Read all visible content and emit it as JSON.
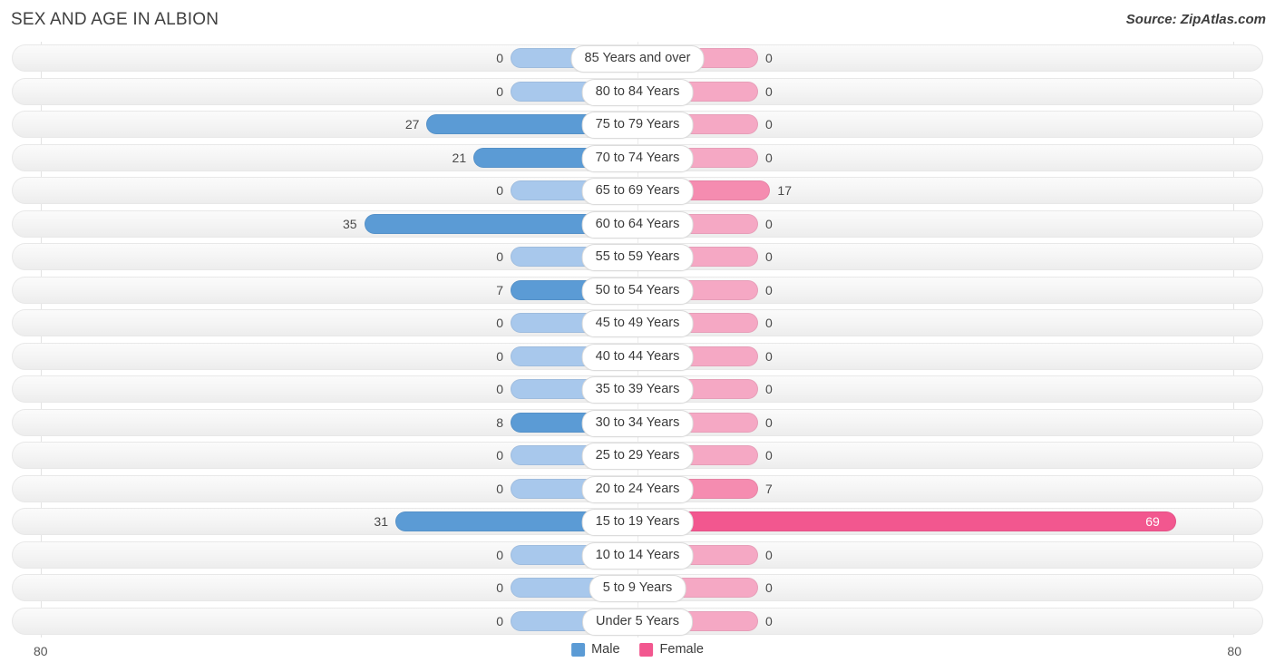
{
  "header": {
    "title": "SEX AND AGE IN ALBION",
    "source": "Source: ZipAtlas.com"
  },
  "legend": {
    "male_label": "Male",
    "female_label": "Female",
    "male_color": "#5b9bd5",
    "female_color": "#f2578f"
  },
  "axis": {
    "left_label": "80",
    "right_label": "80",
    "max": 80
  },
  "colors": {
    "male_active": "#5b9bd5",
    "male_zero": "#a8c8ec",
    "female_active": "#f2578f",
    "female_mid": "#f58cb0",
    "female_zero": "#f5a8c4",
    "track": "#f4f4f4"
  },
  "chart_data": {
    "type": "bar",
    "subtype": "population-pyramid",
    "title": "SEX AND AGE IN ALBION",
    "xlabel": "",
    "ylabel": "",
    "xlim": [
      80,
      80
    ],
    "grid": true,
    "legend_position": "bottom-center",
    "categories": [
      "85 Years and over",
      "80 to 84 Years",
      "75 to 79 Years",
      "70 to 74 Years",
      "65 to 69 Years",
      "60 to 64 Years",
      "55 to 59 Years",
      "50 to 54 Years",
      "45 to 49 Years",
      "40 to 44 Years",
      "35 to 39 Years",
      "30 to 34 Years",
      "25 to 29 Years",
      "20 to 24 Years",
      "15 to 19 Years",
      "10 to 14 Years",
      "5 to 9 Years",
      "Under 5 Years"
    ],
    "series": [
      {
        "name": "Male",
        "values": [
          0,
          0,
          27,
          21,
          0,
          35,
          0,
          7,
          0,
          0,
          0,
          8,
          0,
          0,
          31,
          0,
          0,
          0
        ]
      },
      {
        "name": "Female",
        "values": [
          0,
          0,
          0,
          0,
          17,
          0,
          0,
          0,
          0,
          0,
          0,
          0,
          0,
          7,
          69,
          0,
          0,
          0
        ]
      }
    ]
  },
  "rows": [
    {
      "category": "85 Years and over",
      "male": 0,
      "male_text": "0",
      "female": 0,
      "female_text": "0"
    },
    {
      "category": "80 to 84 Years",
      "male": 0,
      "male_text": "0",
      "female": 0,
      "female_text": "0"
    },
    {
      "category": "75 to 79 Years",
      "male": 27,
      "male_text": "27",
      "female": 0,
      "female_text": "0"
    },
    {
      "category": "70 to 74 Years",
      "male": 21,
      "male_text": "21",
      "female": 0,
      "female_text": "0"
    },
    {
      "category": "65 to 69 Years",
      "male": 0,
      "male_text": "0",
      "female": 17,
      "female_text": "17"
    },
    {
      "category": "60 to 64 Years",
      "male": 35,
      "male_text": "35",
      "female": 0,
      "female_text": "0"
    },
    {
      "category": "55 to 59 Years",
      "male": 0,
      "male_text": "0",
      "female": 0,
      "female_text": "0"
    },
    {
      "category": "50 to 54 Years",
      "male": 7,
      "male_text": "7",
      "female": 0,
      "female_text": "0"
    },
    {
      "category": "45 to 49 Years",
      "male": 0,
      "male_text": "0",
      "female": 0,
      "female_text": "0"
    },
    {
      "category": "40 to 44 Years",
      "male": 0,
      "male_text": "0",
      "female": 0,
      "female_text": "0"
    },
    {
      "category": "35 to 39 Years",
      "male": 0,
      "male_text": "0",
      "female": 0,
      "female_text": "0"
    },
    {
      "category": "30 to 34 Years",
      "male": 8,
      "male_text": "8",
      "female": 0,
      "female_text": "0"
    },
    {
      "category": "25 to 29 Years",
      "male": 0,
      "male_text": "0",
      "female": 0,
      "female_text": "0"
    },
    {
      "category": "20 to 24 Years",
      "male": 0,
      "male_text": "0",
      "female": 7,
      "female_text": "7"
    },
    {
      "category": "15 to 19 Years",
      "male": 31,
      "male_text": "31",
      "female": 69,
      "female_text": "69"
    },
    {
      "category": "10 to 14 Years",
      "male": 0,
      "male_text": "0",
      "female": 0,
      "female_text": "0"
    },
    {
      "category": "5 to 9 Years",
      "male": 0,
      "male_text": "0",
      "female": 0,
      "female_text": "0"
    },
    {
      "category": "Under 5 Years",
      "male": 0,
      "male_text": "0",
      "female": 0,
      "female_text": "0"
    }
  ]
}
